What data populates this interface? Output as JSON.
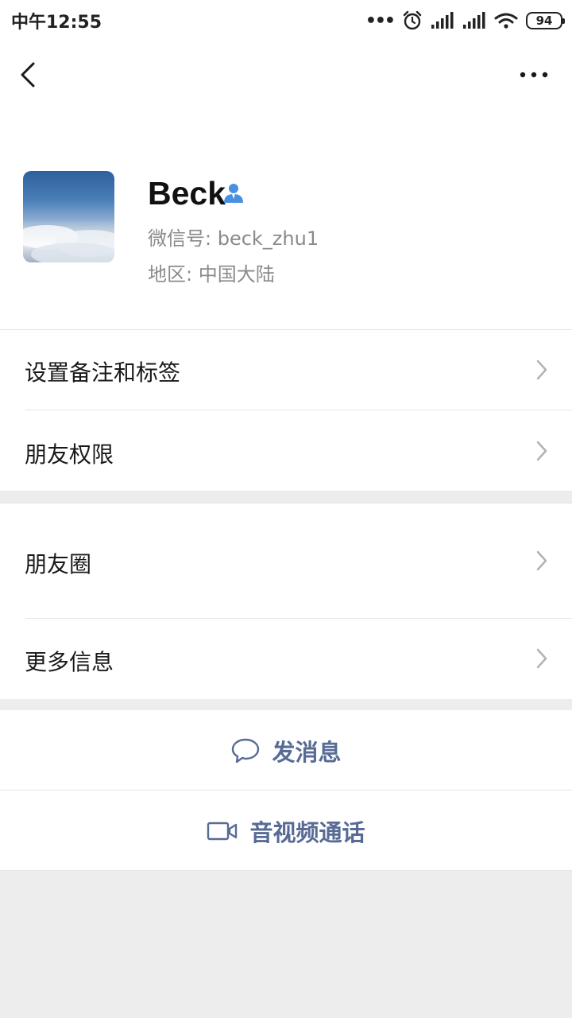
{
  "status_bar": {
    "time": "中午12:55",
    "dots": "•••",
    "battery": "94"
  },
  "profile": {
    "name": "Beck",
    "wechat_id_line": "微信号: beck_zhu1",
    "region_line": "地区: 中国大陆"
  },
  "menu": {
    "remark_tags": "设置备注和标签",
    "friend_permissions": "朋友权限",
    "moments": "朋友圈",
    "more_info": "更多信息"
  },
  "actions": {
    "send_message": "发消息",
    "av_call": "音视频通话"
  },
  "colors": {
    "link_blue": "#576b95",
    "background": "#ededed",
    "surface": "#ffffff"
  },
  "icons": [
    "back-arrow-icon",
    "more-dots-icon",
    "person-icon",
    "chevron-right-icon",
    "chat-bubble-icon",
    "video-camera-icon",
    "alarm-icon",
    "signal-icon",
    "wifi-icon",
    "battery-icon"
  ]
}
